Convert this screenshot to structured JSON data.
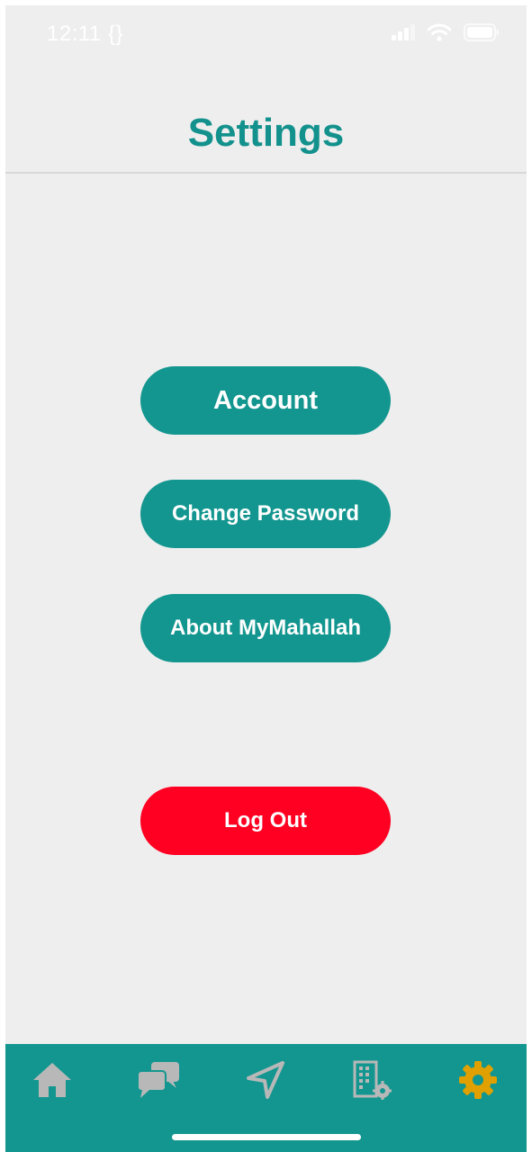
{
  "status_bar": {
    "time": "12:11 {}"
  },
  "header": {
    "title": "Settings"
  },
  "menu": {
    "account_label": "Account",
    "change_password_label": "Change Password",
    "about_label": "About MyMahallah",
    "logout_label": "Log Out"
  },
  "tabbar": {
    "tabs": [
      {
        "icon": "home-icon",
        "active": false
      },
      {
        "icon": "chat-icon",
        "active": false
      },
      {
        "icon": "navigation-icon",
        "active": false
      },
      {
        "icon": "building-settings-icon",
        "active": false
      },
      {
        "icon": "gear-icon",
        "active": true
      }
    ],
    "active_color": "#e0a100",
    "inactive_color": "#b8b8b8"
  },
  "colors": {
    "accent": "#13968f",
    "danger": "#ff0022",
    "title": "#13918d"
  }
}
